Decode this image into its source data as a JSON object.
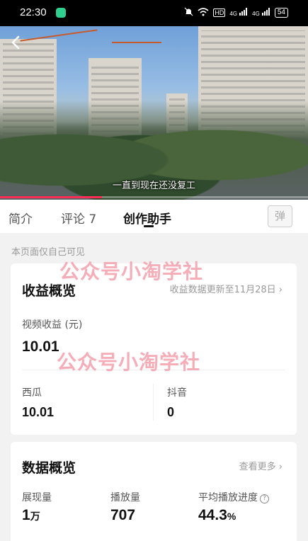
{
  "status_bar": {
    "time": "22:30",
    "icons": [
      "bell-muted-icon",
      "wifi-icon",
      "hd-icon",
      "signal-icon",
      "signal-icon"
    ],
    "hd": "HD",
    "net1": "4G",
    "net2": "4G",
    "battery": "54"
  },
  "video": {
    "subtitle": "一直到现在还没复工",
    "progress": 0.33
  },
  "tabs": [
    {
      "label": "简介"
    },
    {
      "label": "评论 7"
    },
    {
      "label": "创作助手"
    }
  ],
  "danmu_label": "弹",
  "hint": "本页面仅自己可见",
  "watermark": "公众号小淘学社",
  "revenue": {
    "title": "收益概览",
    "update_link": "收益数据更新至11月28日 ›",
    "video_revenue_label": "视频收益 (元)",
    "video_revenue_value": "10.01",
    "xigua_label": "西瓜",
    "xigua_value": "10.01",
    "douyin_label": "抖音",
    "douyin_value": "0"
  },
  "data_overview": {
    "title": "数据概览",
    "more_link": "查看更多 ›",
    "impressions_label": "展现量",
    "impressions_value": "1",
    "impressions_unit": "万",
    "plays_label": "播放量",
    "plays_value": "707",
    "avg_progress_label": "平均播放进度",
    "avg_progress_value": "44.3",
    "avg_progress_unit": "%",
    "help_glyph": "?"
  },
  "colors": {
    "accent": "#ff2c55",
    "watermark": "#f4a0ac",
    "background": "#f2f2f2"
  }
}
